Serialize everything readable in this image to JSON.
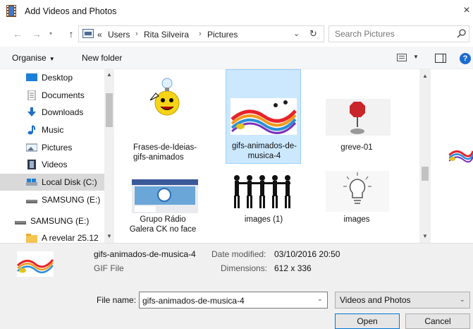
{
  "window": {
    "title": "Add Videos and Photos",
    "close_glyph": "×"
  },
  "nav": {
    "back_glyph": "←",
    "forward_glyph": "→",
    "recent_glyph": "▾",
    "up_glyph": "↑",
    "breadcrumb_prefix": "«",
    "breadcrumbs": [
      "Users",
      "Rita Silveira",
      "Pictures"
    ],
    "separator": "›",
    "dropdown_glyph": "⌄",
    "refresh_glyph": "↻",
    "search_placeholder": "Search Pictures"
  },
  "toolbar": {
    "organise_label": "Organise",
    "organise_caret": "▼",
    "new_folder_label": "New folder",
    "view_caret": "▼",
    "help_glyph": "?"
  },
  "sidebar": {
    "scroll_up_glyph": "▲",
    "scroll_down_glyph": "▼",
    "items": [
      {
        "label": "Desktop",
        "icon": "desktop-icon"
      },
      {
        "label": "Documents",
        "icon": "documents-icon"
      },
      {
        "label": "Downloads",
        "icon": "downloads-icon"
      },
      {
        "label": "Music",
        "icon": "music-icon"
      },
      {
        "label": "Pictures",
        "icon": "pictures-icon"
      },
      {
        "label": "Videos",
        "icon": "videos-icon"
      },
      {
        "label": "Local Disk (C:)",
        "icon": "drive-icon",
        "selected": true
      },
      {
        "label": "SAMSUNG (E:)",
        "icon": "usb-drive-icon"
      },
      {
        "label": "SAMSUNG (E:)",
        "icon": "usb-drive-icon"
      },
      {
        "label": "A revelar 25.12",
        "icon": "folder-icon"
      }
    ]
  },
  "files": [
    {
      "name": "Frases-de-Ideias-gifs-animados",
      "thumb": "lightbulb-smiley-thumbnail"
    },
    {
      "name": "gifs-animados-de-musica-4",
      "thumb": "music-notes-thumbnail",
      "selected": true
    },
    {
      "name": "greve-01",
      "thumb": "strike-sign-thumbnail"
    },
    {
      "name": "Grupo Rádio Galera CK no face",
      "thumb": "facebook-page-thumbnail"
    },
    {
      "name": "images (1)",
      "thumb": "people-silhouettes-thumbnail"
    },
    {
      "name": "images",
      "thumb": "lightbulb-outline-thumbnail"
    }
  ],
  "filearea_scroll": {
    "up_glyph": "▲",
    "down_glyph": "▼"
  },
  "details": {
    "name": "gifs-animados-de-musica-4",
    "type": "GIF File",
    "modified_label": "Date modified:",
    "modified_value": "03/10/2016 20:50",
    "dimensions_label": "Dimensions:",
    "dimensions_value": "612 x 336"
  },
  "bottom": {
    "file_name_label": "File name:",
    "file_name_value": "gifs-animados-de-musica-4",
    "file_name_caret": "⌄",
    "filter_value": "Videos and Photos",
    "filter_caret": "⌄",
    "open_label": "Open",
    "cancel_label": "Cancel"
  },
  "colors": {
    "accent": "#0078d7",
    "selection": "#cce8ff",
    "selection_border": "#99d1ff"
  }
}
